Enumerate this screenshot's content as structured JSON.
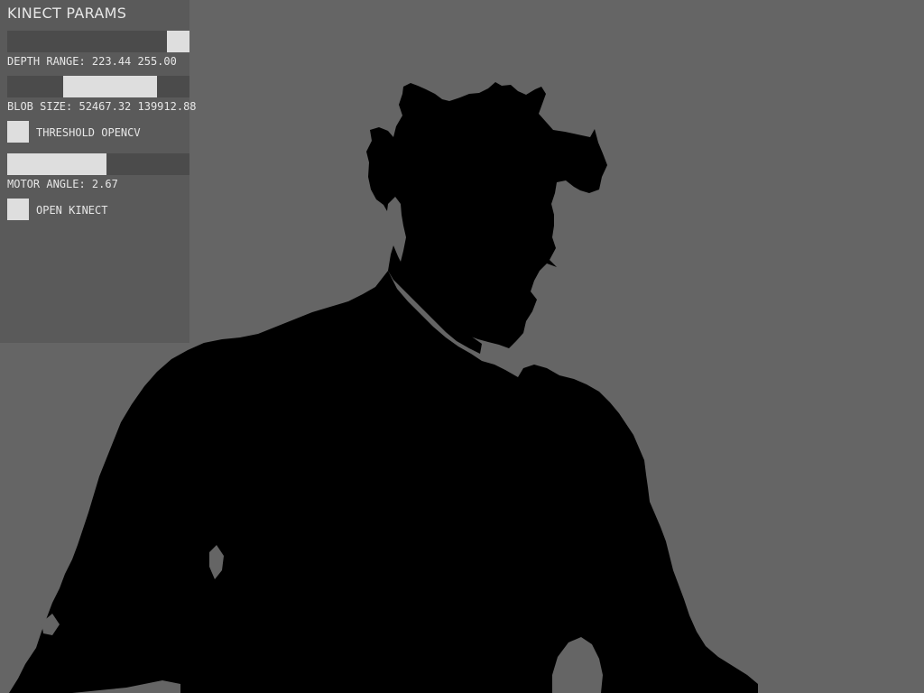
{
  "panel": {
    "title": "KINECT PARAMS",
    "depth_range": {
      "label": "DEPTH RANGE: 223.44 255.00",
      "min": 0,
      "max": 255,
      "low": 223.44,
      "high": 255.0
    },
    "blob_size": {
      "label": "BLOB SIZE: 52467.32 139912.88",
      "min": 0,
      "max": 170000,
      "low": 52467.32,
      "high": 139912.88
    },
    "threshold_opencv": {
      "label": "THRESHOLD OPENCV",
      "checked": true
    },
    "motor_angle": {
      "label": "MOTOR ANGLE: 2.67",
      "min": -30,
      "max": 30,
      "value": 2.67
    },
    "open_kinect": {
      "label": "OPEN KINECT",
      "checked": true
    }
  },
  "colors": {
    "background": "#656565",
    "panel": "#5a5a5a",
    "track": "#4b4b4b",
    "fill": "#dedede",
    "text": "#e6e6e6",
    "silhouette": "#000000"
  }
}
